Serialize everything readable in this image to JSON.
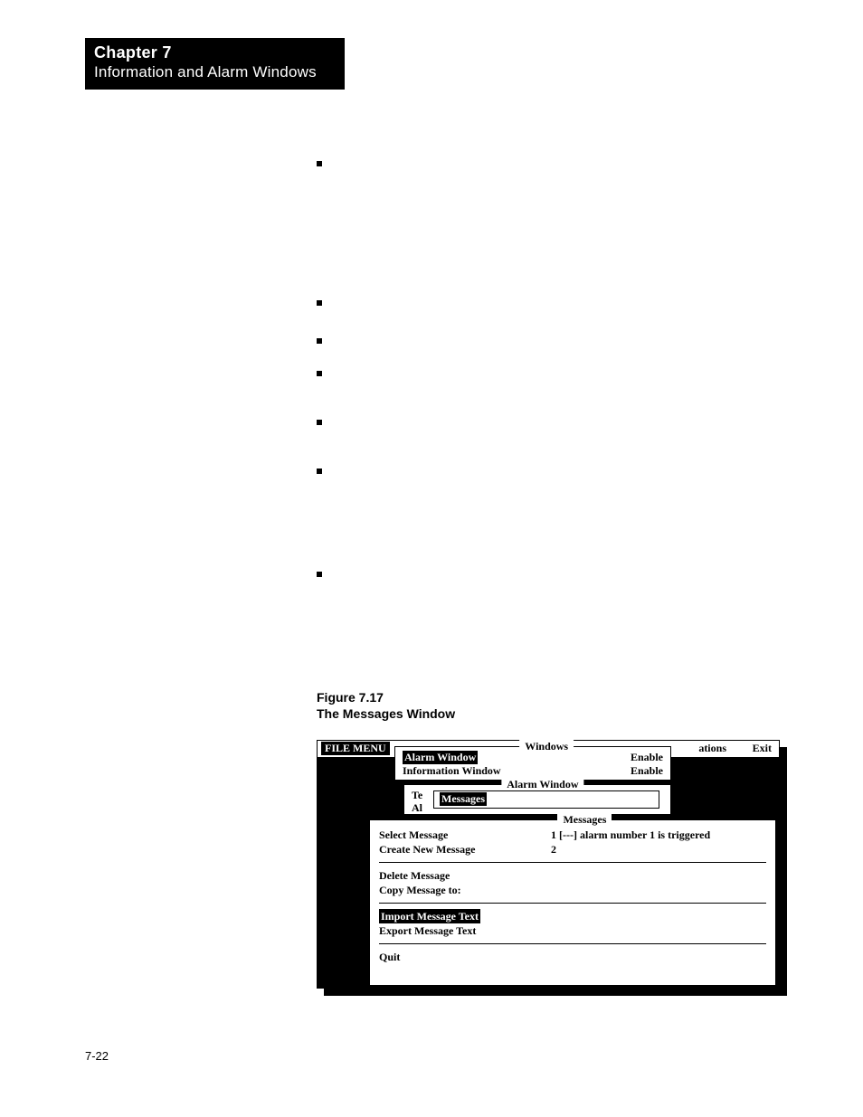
{
  "chapter": {
    "number": "Chapter 7",
    "title": "Information and Alarm Windows"
  },
  "bullets": [
    {
      "text": ""
    },
    {
      "text": ""
    },
    {
      "text": ""
    },
    {
      "text": ""
    },
    {
      "text": ""
    },
    {
      "text": ""
    },
    {
      "text": ""
    }
  ],
  "figure": {
    "number": "Figure 7.17",
    "title": "The Messages Window"
  },
  "menubar": {
    "filemenu": "FILE MENU",
    "ations": "ations",
    "exit": "Exit"
  },
  "windows_panel": {
    "title": "Windows",
    "rows": [
      {
        "label": "Alarm Window",
        "value": "Enable",
        "hl": true
      },
      {
        "label": "Information Window",
        "value": "Enable",
        "hl": false
      }
    ]
  },
  "alarm_panel": {
    "title": "Alarm Window",
    "te": "Te",
    "al": "Al",
    "messages_label": "Messages"
  },
  "messages_panel": {
    "title": "Messages",
    "left": {
      "select": "Select Message",
      "create": "Create New Message",
      "delete": "Delete Message",
      "copy": "Copy Message to:",
      "import": "Import Message Text",
      "export": "Export Message Text",
      "quit": "Quit"
    },
    "right": {
      "row1": "1  [---] alarm number 1 is triggered",
      "row2": "2"
    }
  },
  "pagenum": "7-22"
}
